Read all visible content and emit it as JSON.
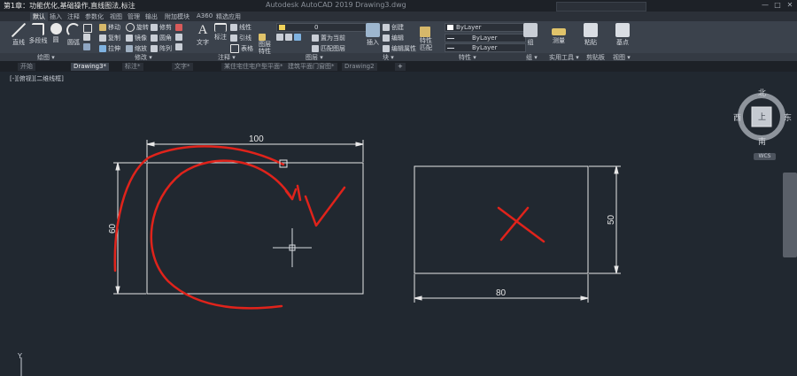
{
  "window": {
    "title": "第1章：功能优化,基础操作,直线图法,标注",
    "app_title": "Autodesk AutoCAD 2019   Drawing3.dwg",
    "controls": [
      "—",
      "□",
      "✕"
    ]
  },
  "ribbon": {
    "tabs": [
      "默认",
      "插入",
      "注释",
      "参数化",
      "视图",
      "管理",
      "输出",
      "附加模块",
      "A360",
      "精选应用"
    ],
    "active_tab": 0,
    "draw": {
      "line": "直线",
      "polyline": "多段线",
      "circle": "圆",
      "arc": "圆弧"
    },
    "modify": {
      "move": "移动",
      "rotate": "旋转",
      "trim": "修剪",
      "copy": "复制",
      "mirror": "镜像",
      "fillet": "圆角",
      "stretch": "拉伸",
      "scale": "缩放",
      "array": "阵列"
    },
    "annotation": {
      "text": "文字",
      "dimension": "标注",
      "linear": "线性",
      "leader": "引线",
      "table": "表格"
    },
    "layers": {
      "layer_props": "图层特性",
      "current_layer": "0",
      "make_current": "置为当前",
      "match_layer": "匹配图层"
    },
    "block": {
      "insert": "插入",
      "create": "创建",
      "edit": "编辑",
      "edit_attributes": "编辑属性"
    },
    "properties": {
      "match": "特性匹配",
      "color": "ByLayer",
      "linetype": "ByLayer",
      "lineweight": "ByLayer"
    },
    "groups": {
      "group": "组"
    },
    "utilities": {
      "measure": "测量"
    },
    "clipboard": {
      "paste": "粘贴"
    },
    "view": {
      "base": "基点"
    },
    "panel_titles": [
      "绘图 ▾",
      "修改 ▾",
      "注释 ▾",
      "图层 ▾",
      "块 ▾",
      "特性 ▾",
      "组 ▾",
      "实用工具 ▾",
      "剪贴板",
      "视图 ▾"
    ]
  },
  "doc_tabs": [
    "开始",
    "Drawing3*",
    "标注*",
    "文字*",
    "某住宅住宅户型平面*",
    "建筑平面门窗图*",
    "Drawing2"
  ],
  "active_doc": 1,
  "viewport": {
    "label": "[-][俯视][二维线框]"
  },
  "dimensions": {
    "width_left": "100",
    "height_left": "60",
    "height_right": "50",
    "width_right": "80"
  },
  "viewcube": {
    "north": "北",
    "south": "南",
    "east": "东",
    "west": "西",
    "top": "上",
    "wcs": "WCS"
  },
  "ucs": {
    "y": "Y"
  },
  "colors": {
    "canvas": "#212830",
    "ribbon": "#3b424c",
    "annotation_red": "#e0231b",
    "dimension_line": "#e8e8e8"
  }
}
